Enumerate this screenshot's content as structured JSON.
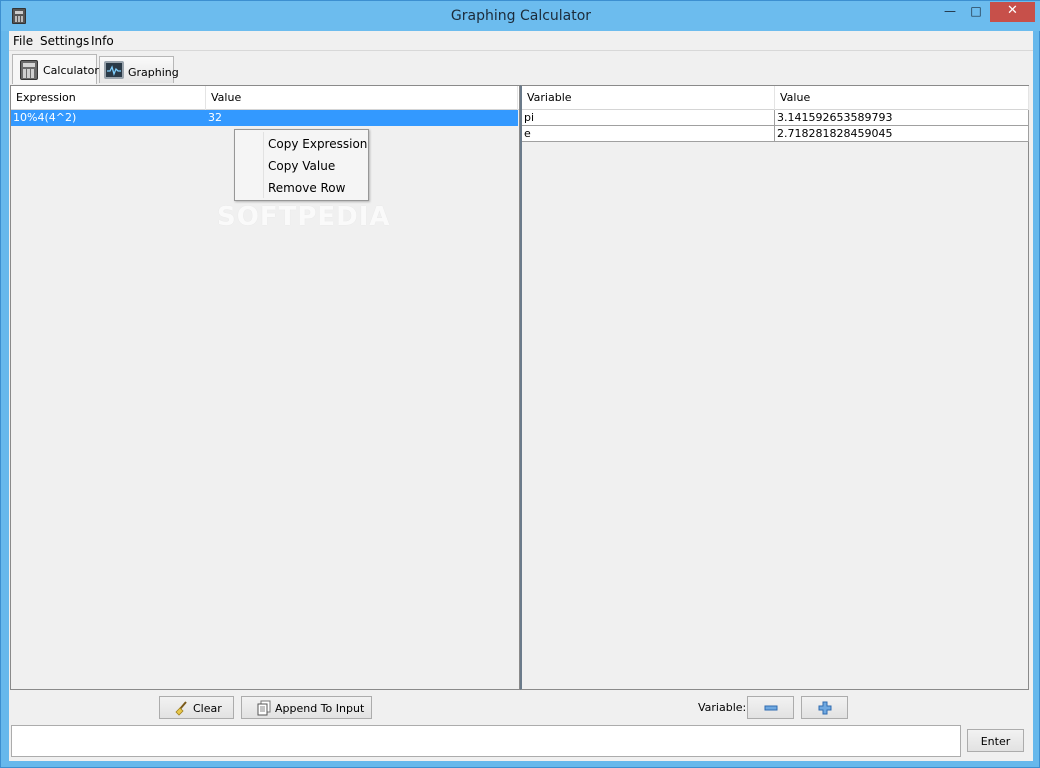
{
  "window": {
    "title": "Graphing Calculator",
    "controls": {
      "minimize": "—",
      "maximize": "□",
      "close": "✕"
    }
  },
  "menu": [
    "File",
    "Settings",
    "Info"
  ],
  "tabs": [
    {
      "label": "Calculator",
      "icon": "calculator-icon",
      "active": true
    },
    {
      "label": "Graphing",
      "icon": "graph-icon",
      "active": false
    }
  ],
  "history_table": {
    "columns": [
      "Expression",
      "Value"
    ],
    "rows": [
      {
        "expression": "10%4(4^2)",
        "value": "32",
        "selected": true
      }
    ]
  },
  "context_menu": {
    "items": [
      "Copy Expression",
      "Copy Value",
      "Remove Row"
    ]
  },
  "variables_table": {
    "columns": [
      "Variable",
      "Value"
    ],
    "rows": [
      {
        "variable": "pi",
        "value": "3.141592653589793"
      },
      {
        "variable": "e",
        "value": "2.718281828459045"
      }
    ]
  },
  "buttons": {
    "clear": "Clear",
    "append": "Append To Input",
    "variable_label": "Variable:",
    "remove_var": "−",
    "add_var": "+",
    "enter": "Enter"
  },
  "input": {
    "value": ""
  },
  "watermark": "SOFTPEDIA",
  "colors": {
    "selection": "#3399ff",
    "titlebar": "#6cbcee",
    "close": "#c7504a"
  }
}
